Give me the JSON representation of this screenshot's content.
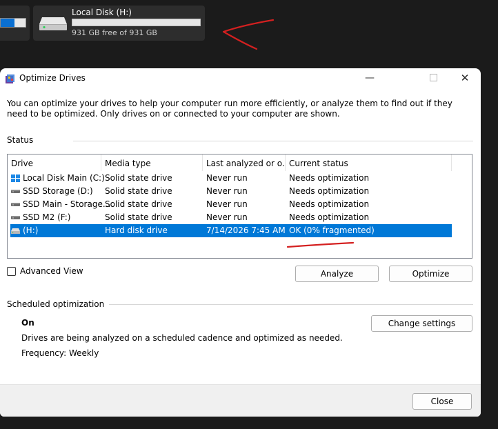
{
  "explorer": {
    "left_tile_used_fraction": 0.55,
    "drive_tile": {
      "name": "Local Disk (H:)",
      "free_text": "931 GB free of 931 GB",
      "used_fraction": 0.0
    }
  },
  "dialog": {
    "title": "Optimize Drives",
    "intro": "You can optimize your drives to help your computer run more efficiently, or analyze them to find out if they need to be optimized. Only drives on or connected to your computer are shown.",
    "status_label": "Status",
    "columns": [
      "Drive",
      "Media type",
      "Last analyzed or o...",
      "Current status"
    ],
    "drives": [
      {
        "name": "Local Disk Main (C:)",
        "media": "Solid state drive",
        "last": "Never run",
        "status": "Needs optimization",
        "icon": "windows-drive-icon"
      },
      {
        "name": "SSD Storage (D:)",
        "media": "Solid state drive",
        "last": "Never run",
        "status": "Needs optimization",
        "icon": "drive-icon"
      },
      {
        "name": "SSD Main - Storage...",
        "media": "Solid state drive",
        "last": "Never run",
        "status": "Needs optimization",
        "icon": "drive-icon"
      },
      {
        "name": "SSD M2  (F:)",
        "media": "Solid state drive",
        "last": "Never run",
        "status": "Needs optimization",
        "icon": "drive-icon"
      },
      {
        "name": "(H:)",
        "media": "Hard disk drive",
        "last": "7/14/2026 7:45 AM",
        "status": "OK (0% fragmented)",
        "icon": "hard-disk-icon",
        "selected": true
      }
    ],
    "advanced_view_label": "Advanced View",
    "advanced_view_checked": false,
    "analyze_label": "Analyze",
    "optimize_label": "Optimize",
    "scheduled_label": "Scheduled optimization",
    "schedule_state": "On",
    "schedule_desc": "Drives are being analyzed on a scheduled cadence and optimized as needed.",
    "frequency": "Frequency: Weekly",
    "change_settings_label": "Change settings",
    "close_label": "Close"
  },
  "colors": {
    "accent": "#0078d7",
    "annotation_red": "#d42020",
    "background": "#1b1b1b"
  }
}
